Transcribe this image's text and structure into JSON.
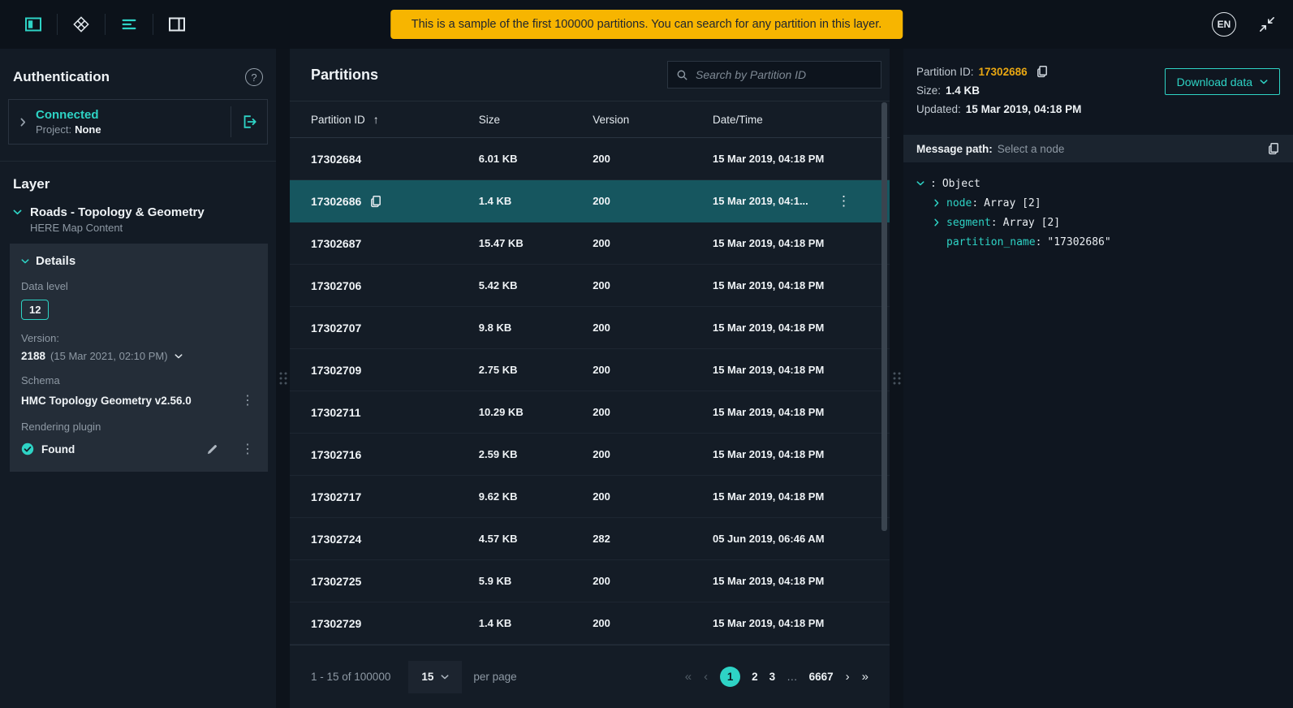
{
  "colors": {
    "accent_teal": "#2ed3c5",
    "banner_yellow": "#f7b500",
    "selected_row": "#16565f",
    "partition_id_amber": "#e9a712"
  },
  "icons": {
    "help": "?",
    "kebab": "⋮",
    "sort_asc": "↑",
    "first": "«",
    "prev": "‹",
    "next": "›",
    "last": "»"
  },
  "header": {
    "banner_text": "This is a sample of the first 100000 partitions. You can search for any partition in this layer.",
    "language": "EN"
  },
  "auth": {
    "title": "Authentication",
    "status": "Connected",
    "project_label": "Project:",
    "project_value": "None"
  },
  "layer": {
    "section_title": "Layer",
    "name": "Roads - Topology & Geometry",
    "catalog": "HERE Map Content",
    "details": {
      "title": "Details",
      "data_level_label": "Data level",
      "data_level_value": "12",
      "version_label": "Version:",
      "version_value": "2188",
      "version_date": "(15 Mar 2021, 02:10 PM)",
      "schema_label": "Schema",
      "schema_value": "HMC Topology Geometry v2.56.0",
      "rendering_plugin_label": "Rendering plugin",
      "rendering_plugin_status": "Found"
    }
  },
  "partitions": {
    "title": "Partitions",
    "search_placeholder": "Search by Partition ID",
    "columns": [
      "Partition ID",
      "Size",
      "Version",
      "Date/Time"
    ],
    "rows": [
      {
        "id": "17302684",
        "size": "6.01 KB",
        "version": "200",
        "datetime": "15 Mar 2019, 04:18 PM"
      },
      {
        "id": "17302686",
        "size": "1.4 KB",
        "version": "200",
        "datetime": "15 Mar 2019, 04:1...",
        "selected": true
      },
      {
        "id": "17302687",
        "size": "15.47 KB",
        "version": "200",
        "datetime": "15 Mar 2019, 04:18 PM"
      },
      {
        "id": "17302706",
        "size": "5.42 KB",
        "version": "200",
        "datetime": "15 Mar 2019, 04:18 PM"
      },
      {
        "id": "17302707",
        "size": "9.8 KB",
        "version": "200",
        "datetime": "15 Mar 2019, 04:18 PM"
      },
      {
        "id": "17302709",
        "size": "2.75 KB",
        "version": "200",
        "datetime": "15 Mar 2019, 04:18 PM"
      },
      {
        "id": "17302711",
        "size": "10.29 KB",
        "version": "200",
        "datetime": "15 Mar 2019, 04:18 PM"
      },
      {
        "id": "17302716",
        "size": "2.59 KB",
        "version": "200",
        "datetime": "15 Mar 2019, 04:18 PM"
      },
      {
        "id": "17302717",
        "size": "9.62 KB",
        "version": "200",
        "datetime": "15 Mar 2019, 04:18 PM"
      },
      {
        "id": "17302724",
        "size": "4.57 KB",
        "version": "282",
        "datetime": "05 Jun 2019, 06:46 AM"
      },
      {
        "id": "17302725",
        "size": "5.9 KB",
        "version": "200",
        "datetime": "15 Mar 2019, 04:18 PM"
      },
      {
        "id": "17302729",
        "size": "1.4 KB",
        "version": "200",
        "datetime": "15 Mar 2019, 04:18 PM"
      }
    ],
    "pagination": {
      "range_text": "1 - 15 of 100000",
      "page_size": "15",
      "per_page_label": "per page",
      "pages": [
        {
          "label": "1",
          "active": true
        },
        {
          "label": "2"
        },
        {
          "label": "3"
        },
        {
          "label": "…",
          "ellipsis": true
        },
        {
          "label": "6667"
        }
      ]
    }
  },
  "inspector": {
    "id_label": "Partition ID:",
    "id_value": "17302686",
    "size_label": "Size:",
    "size_value": "1.4 KB",
    "updated_label": "Updated:",
    "updated_value": "15 Mar 2019, 04:18 PM",
    "download_button": "Download data",
    "message_path_label": "Message path:",
    "message_path_hint": "Select a node",
    "tree": [
      {
        "key": "",
        "colon": ":",
        "value": "Object",
        "open": true
      },
      {
        "key": "node",
        "colon": ":",
        "value": "Array [2]",
        "closed": true,
        "indented": true
      },
      {
        "key": "segment",
        "colon": ":",
        "value": "Array [2]",
        "closed": true,
        "indented": true
      },
      {
        "key": "partition_name",
        "colon": ":",
        "value": "\"17302686\"",
        "leaf": true,
        "indented": true
      }
    ]
  }
}
